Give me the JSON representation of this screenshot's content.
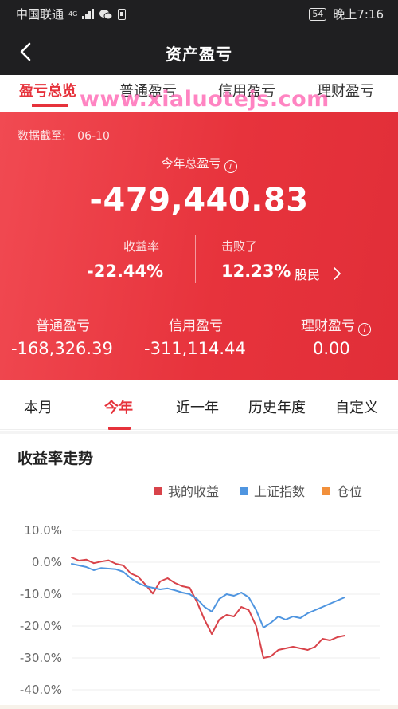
{
  "status_bar": {
    "carrier": "中国联通",
    "network": "4G",
    "battery": "54",
    "time": "晚上7:16"
  },
  "nav": {
    "title": "资产盈亏",
    "back_icon": "chevron-left-icon"
  },
  "top_tabs": {
    "items": [
      "盈亏总览",
      "普通盈亏",
      "信用盈亏",
      "理财盈亏"
    ],
    "active": 0
  },
  "watermark": "www.xialuotejs.com",
  "summary": {
    "as_of_label": "数据截至:",
    "as_of_date": "06-10",
    "total_label": "今年总盈亏",
    "total_value": "-479,440.83",
    "rate_label": "收益率",
    "rate_value": "-22.44%",
    "beat_label": "击败了",
    "beat_value": "12.23%",
    "beat_suffix": "股民",
    "breakdown": [
      {
        "label": "普通盈亏",
        "value": "-168,326.39"
      },
      {
        "label": "信用盈亏",
        "value": "-311,114.44"
      },
      {
        "label": "理财盈亏",
        "value": "0.00"
      }
    ]
  },
  "period_tabs": {
    "items": [
      "本月",
      "今年",
      "近一年",
      "历史年度",
      "自定义"
    ],
    "active": 1
  },
  "chart_section": {
    "title": "收益率走势"
  },
  "chart_data": {
    "type": "line",
    "title": "收益率走势",
    "y_unit": "%",
    "ylim": [
      -40,
      10
    ],
    "yticks": [
      10,
      0,
      -10,
      -20,
      -30,
      -40
    ],
    "ytick_labels": [
      "10.0%",
      "0.0%",
      "-10.0%",
      "-20.0%",
      "-30.0%",
      "-40.0%"
    ],
    "grid": true,
    "legend_position": "top-right",
    "legend": [
      {
        "name": "我的收益",
        "color": "#d8434a"
      },
      {
        "name": "上证指数",
        "color": "#4f95e0"
      },
      {
        "name": "仓位",
        "color": "#f2903b"
      }
    ],
    "series": [
      {
        "name": "我的收益",
        "color": "#d8434a",
        "values": [
          1.5,
          0.5,
          0.8,
          -0.3,
          0.2,
          0.6,
          -0.5,
          -1.0,
          -3.5,
          -4.5,
          -7.0,
          -9.8,
          -6.0,
          -5.0,
          -6.5,
          -7.5,
          -8.0,
          -12.5,
          -18.0,
          -22.5,
          -18.0,
          -16.5,
          -17.0,
          -14.0,
          -15.0,
          -20.0,
          -30.0,
          -29.5,
          -27.5,
          -27.0,
          -26.5,
          -27.0,
          -27.5,
          -26.5,
          -24.0,
          -24.5,
          -23.5,
          -23.0
        ]
      },
      {
        "name": "上证指数",
        "color": "#4f95e0",
        "values": [
          -0.5,
          -1.0,
          -1.5,
          -2.5,
          -1.8,
          -2.0,
          -2.2,
          -3.0,
          -5.0,
          -6.5,
          -7.5,
          -8.0,
          -8.5,
          -8.2,
          -8.8,
          -9.5,
          -10.0,
          -11.5,
          -14.0,
          -15.5,
          -11.5,
          -10.0,
          -10.5,
          -9.5,
          -11.0,
          -15.0,
          -20.5,
          -19.0,
          -17.0,
          -18.0,
          -17.0,
          -17.5,
          -16.0,
          -15.0,
          -14.0,
          -13.0,
          -12.0,
          -11.0
        ]
      },
      {
        "name": "仓位",
        "color": "#f2903b",
        "values": []
      }
    ]
  }
}
